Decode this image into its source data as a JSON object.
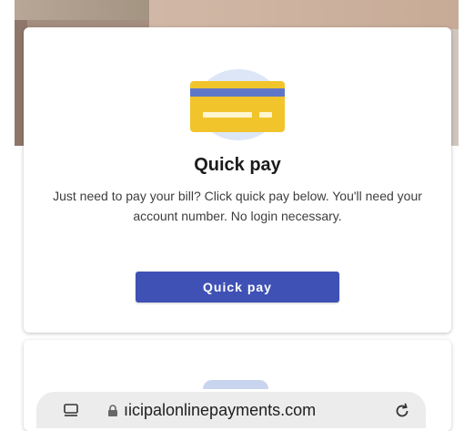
{
  "quick_pay": {
    "icon": "credit-card-icon",
    "title": "Quick pay",
    "description": "Just need to pay your bill? Click quick pay below. You'll need your account number. No login necessary.",
    "button_label": "Quick pay",
    "accent_color": "#3f51b5",
    "card_icon_color": "#f2c42b"
  },
  "browser": {
    "url": "ıicipalonlinepayments.com",
    "tabs_icon": "tabs-icon",
    "lock_icon": "lock-icon",
    "reload_icon": "reload-icon"
  }
}
